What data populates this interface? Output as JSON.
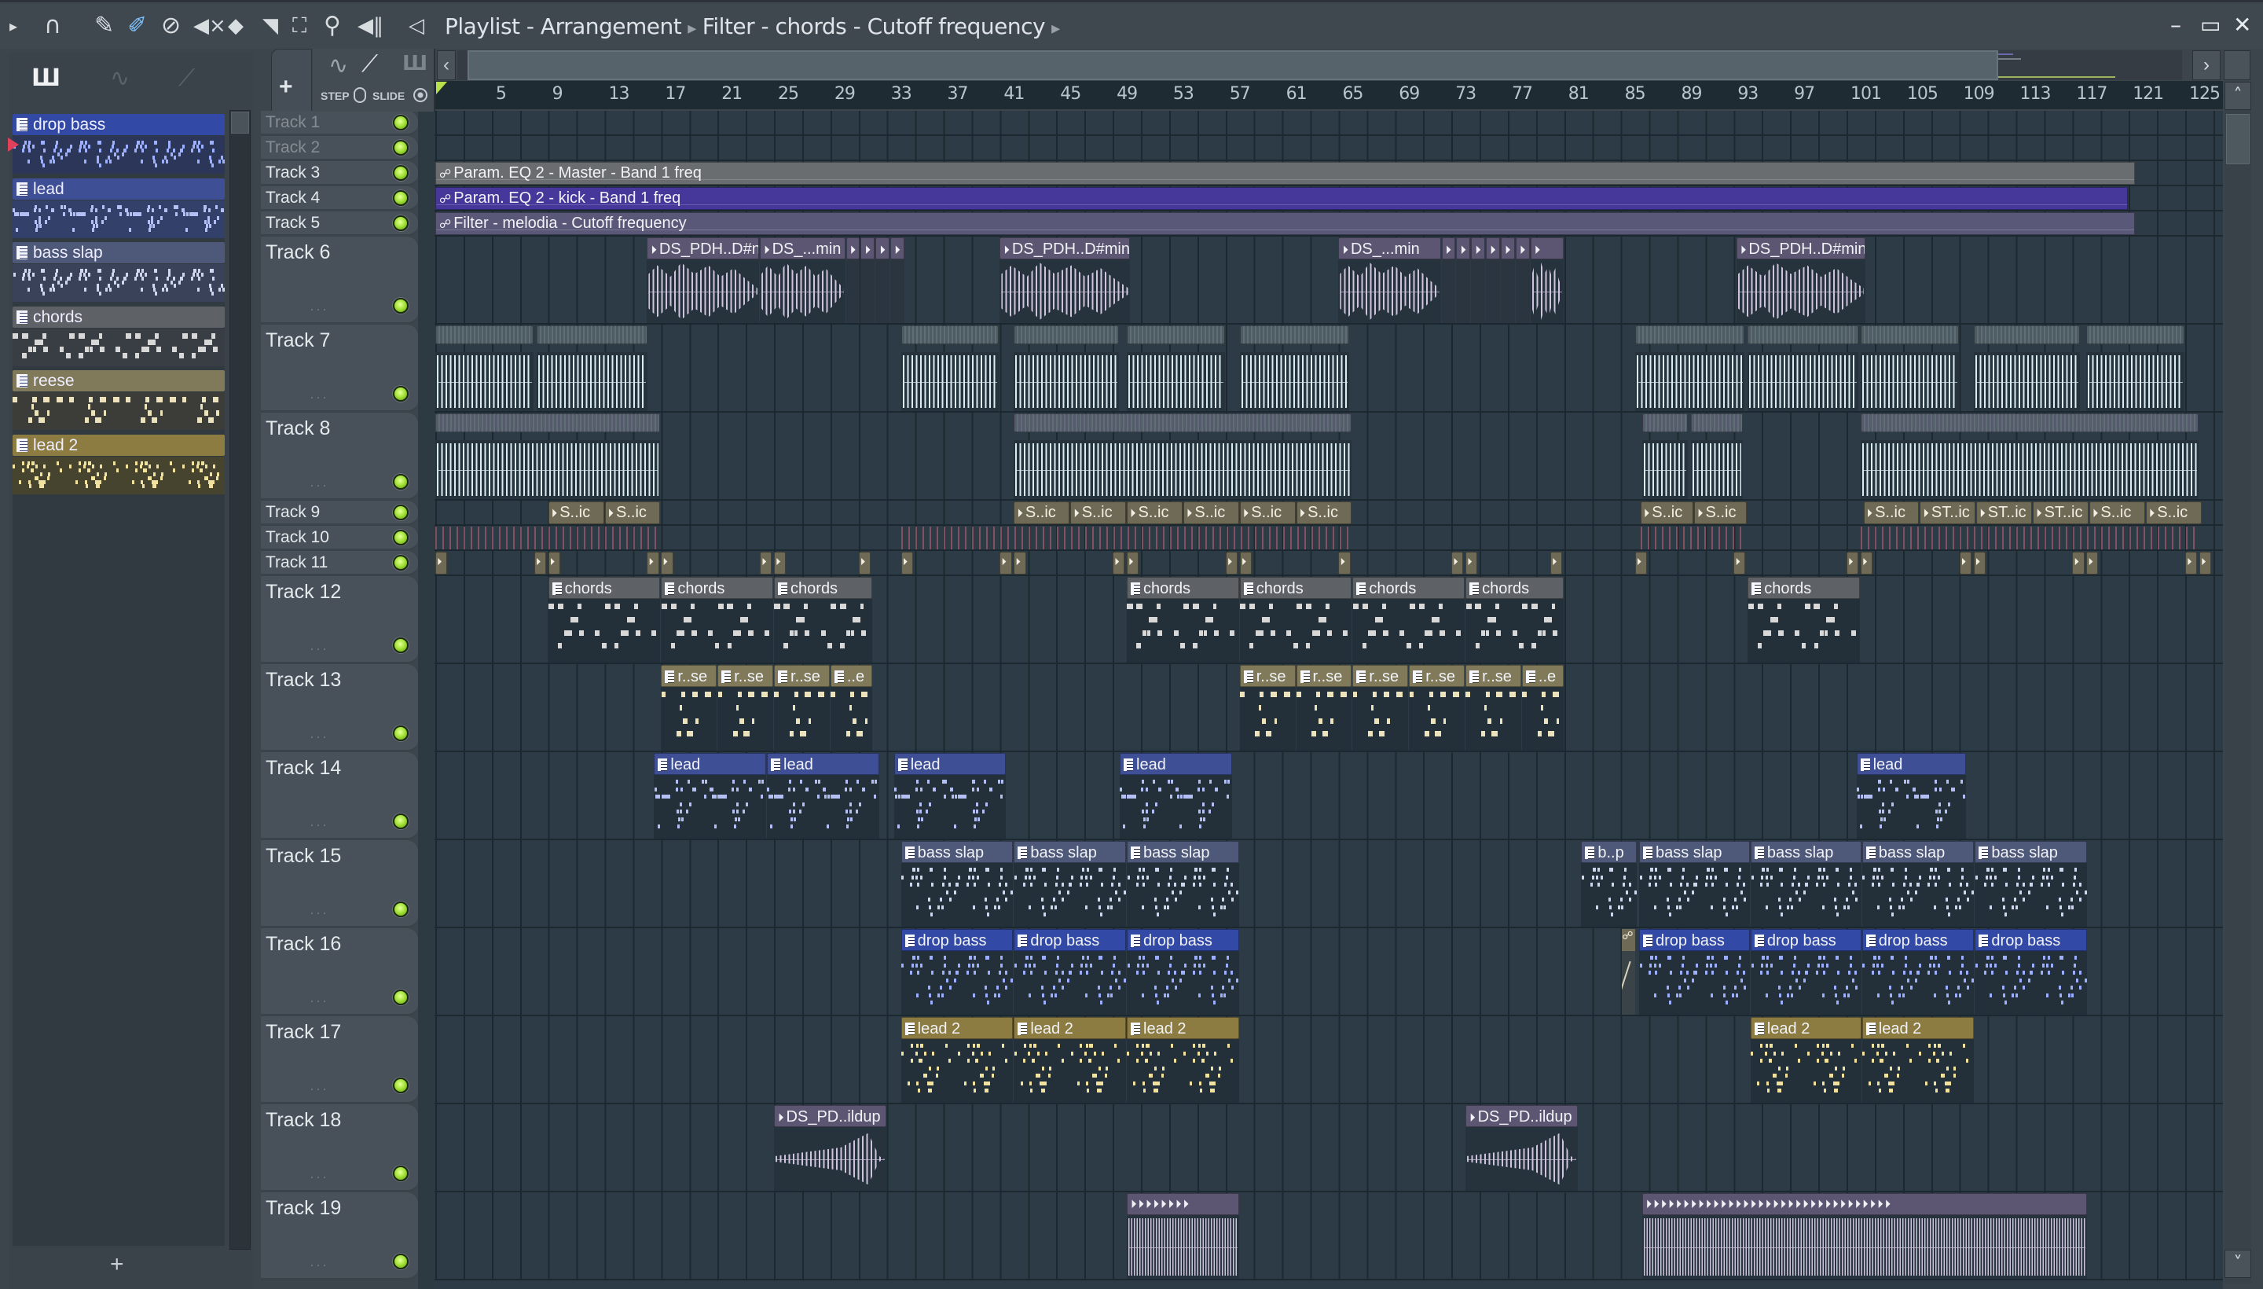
{
  "window": {
    "breadcrumb": [
      "Playlist - Arrangement",
      "Filter - chords - Cutoff frequency"
    ],
    "controls": [
      "minimize-icon",
      "maximize-icon",
      "close-icon"
    ]
  },
  "toolbar": {
    "icons": [
      "menu-arrow-icon",
      "magnet-snap-icon",
      "pencil-draw-icon",
      "paint-brush-icon",
      "delete-icon",
      "mute-icon",
      "slip-icon",
      "slice-icon",
      "select-icon",
      "zoom-icon",
      "playback-icon",
      "speaker-icon"
    ]
  },
  "left_panel": {
    "tool_icons": [
      "piano-roll-icon",
      "audio-clip-icon",
      "automation-clip-icon"
    ],
    "add_label": "+",
    "patterns": [
      {
        "name": "drop bass",
        "kind": "drop-bass"
      },
      {
        "name": "lead",
        "kind": "lead"
      },
      {
        "name": "bass slap",
        "kind": "bass-slap"
      },
      {
        "name": "chords",
        "kind": "chords"
      },
      {
        "name": "reese",
        "kind": "reese"
      },
      {
        "name": "lead 2",
        "kind": "lead2"
      }
    ]
  },
  "playlist_tools": {
    "add_label": "+",
    "step_label": "STEP",
    "slide_label": "SLIDE"
  },
  "ruler": {
    "ticks": [
      5,
      9,
      13,
      17,
      21,
      25,
      29,
      33,
      37,
      41,
      45,
      49,
      53,
      57,
      61,
      65,
      69,
      73,
      77,
      81,
      85,
      89,
      93,
      97,
      101,
      105,
      109,
      113,
      117,
      121,
      125
    ],
    "playhead_bar": 1
  },
  "tracks": [
    "Track 1",
    "Track 2",
    "Track 3",
    "Track 4",
    "Track 5",
    "Track 6",
    "Track 7",
    "Track 8",
    "Track 9",
    "Track 10",
    "Track 11",
    "Track 12",
    "Track 13",
    "Track 14",
    "Track 15",
    "Track 16",
    "Track 17",
    "Track 18",
    "Track 19"
  ],
  "colors": {
    "drop-bass": {
      "head": "#3349a6",
      "note": "#9cb0ff"
    },
    "lead": {
      "head": "#3f4f96",
      "note": "#b4c0f4"
    },
    "bass-slap": {
      "head": "#4e5878",
      "note": "#d0d6ee"
    },
    "chords": {
      "head": "#5e6165",
      "note": "#d8d8d8"
    },
    "reese": {
      "head": "#817a5a",
      "note": "#ece2bc"
    },
    "lead2": {
      "head": "#8c7c42",
      "note": "#f2e2a0"
    },
    "auto-master": {
      "head": "#6a6d70"
    },
    "auto-kick": {
      "head": "#45389a"
    },
    "auto-melodia": {
      "head": "#5a5878"
    },
    "audio-purple": {
      "head": "#5c5672",
      "wave": "#cfc4e0"
    },
    "audio-teal": {
      "head": "#4c5c62",
      "wave": "#d8ecf2"
    },
    "audio-slate": {
      "head": "#555a6c",
      "wave": "#d8ecf2"
    },
    "tan": {
      "head": "#6f6a55"
    },
    "hits": {
      "head": "#a05a6a"
    }
  },
  "clips": [
    {
      "t": 3,
      "s": 1,
      "l": 120.5,
      "kind": "auto-master",
      "label": "Param. EQ 2 - Master - Band 1 freq"
    },
    {
      "t": 4,
      "s": 1,
      "l": 120,
      "kind": "auto-kick",
      "label": "Param. EQ 2 - kick - Band 1 freq"
    },
    {
      "t": 5,
      "s": 1,
      "l": 120.5,
      "kind": "auto-melodia",
      "label": "Filter - melodia - Cutoff frequency"
    },
    {
      "t": 6,
      "s": 16,
      "l": 8,
      "kind": "audio6",
      "label": "DS_PDH..D#n"
    },
    {
      "t": 6,
      "s": 24,
      "l": 6.1,
      "kind": "audio6",
      "label": "DS_...min"
    },
    {
      "t": 6,
      "s": 30.1,
      "l": 1.05,
      "kind": "audio6",
      "label": ""
    },
    {
      "t": 6,
      "s": 31.15,
      "l": 1.05,
      "kind": "audio6",
      "label": ""
    },
    {
      "t": 6,
      "s": 32.2,
      "l": 1.05,
      "kind": "audio6",
      "label": ""
    },
    {
      "t": 6,
      "s": 33.25,
      "l": 1.05,
      "kind": "audio6",
      "label": ""
    },
    {
      "t": 6,
      "s": 41,
      "l": 9.3,
      "kind": "audio6",
      "label": "DS_PDH..D#min"
    },
    {
      "t": 6,
      "s": 65,
      "l": 7.3,
      "kind": "audio6",
      "label": "DS_...min"
    },
    {
      "t": 6,
      "s": 72.3,
      "l": 1.05,
      "kind": "audio6",
      "label": ""
    },
    {
      "t": 6,
      "s": 73.35,
      "l": 1.05,
      "kind": "audio6",
      "label": ""
    },
    {
      "t": 6,
      "s": 74.4,
      "l": 1.05,
      "kind": "audio6",
      "label": ""
    },
    {
      "t": 6,
      "s": 75.45,
      "l": 1.05,
      "kind": "audio6",
      "label": ""
    },
    {
      "t": 6,
      "s": 76.5,
      "l": 1.05,
      "kind": "audio6",
      "label": ""
    },
    {
      "t": 6,
      "s": 77.55,
      "l": 1.05,
      "kind": "audio6",
      "label": ""
    },
    {
      "t": 6,
      "s": 78.6,
      "l": 2.4,
      "kind": "audio6",
      "label": ""
    },
    {
      "t": 6,
      "s": 93.2,
      "l": 9.2,
      "kind": "audio6",
      "label": "DS_PDH..D#min"
    },
    {
      "t": 7,
      "s": 1,
      "l": 7,
      "kind": "audio7"
    },
    {
      "t": 7,
      "s": 8.2,
      "l": 7.9,
      "kind": "audio7"
    },
    {
      "t": 7,
      "s": 34,
      "l": 7,
      "kind": "audio7"
    },
    {
      "t": 7,
      "s": 42,
      "l": 7.5,
      "kind": "audio7"
    },
    {
      "t": 7,
      "s": 50,
      "l": 7,
      "kind": "audio7"
    },
    {
      "t": 7,
      "s": 58,
      "l": 7.8,
      "kind": "audio7"
    },
    {
      "t": 7,
      "s": 86,
      "l": 7.8,
      "kind": "audio7"
    },
    {
      "t": 7,
      "s": 94,
      "l": 7.9,
      "kind": "audio7"
    },
    {
      "t": 7,
      "s": 102,
      "l": 7,
      "kind": "audio7"
    },
    {
      "t": 7,
      "s": 110,
      "l": 7.6,
      "kind": "audio7"
    },
    {
      "t": 7,
      "s": 118,
      "l": 7,
      "kind": "audio7"
    },
    {
      "t": 8,
      "s": 1,
      "l": 16,
      "kind": "audio8"
    },
    {
      "t": 8,
      "s": 42,
      "l": 24,
      "kind": "audio8"
    },
    {
      "t": 8,
      "s": 86.5,
      "l": 3.3,
      "kind": "audio8"
    },
    {
      "t": 8,
      "s": 90,
      "l": 3.7,
      "kind": "audio8"
    },
    {
      "t": 8,
      "s": 102,
      "l": 24,
      "kind": "audio8"
    },
    {
      "t": 9,
      "s": 9,
      "l": 4,
      "kind": "sic",
      "label": "S..ic"
    },
    {
      "t": 9,
      "s": 13,
      "l": 4,
      "kind": "sic",
      "label": "S..ic"
    },
    {
      "t": 9,
      "s": 42,
      "l": 4,
      "kind": "sic",
      "label": "S..ic"
    },
    {
      "t": 9,
      "s": 46,
      "l": 4,
      "kind": "sic",
      "label": "S..ic"
    },
    {
      "t": 9,
      "s": 50,
      "l": 4,
      "kind": "sic",
      "label": "S..ic"
    },
    {
      "t": 9,
      "s": 54,
      "l": 4,
      "kind": "sic",
      "label": "S..ic"
    },
    {
      "t": 9,
      "s": 58,
      "l": 4,
      "kind": "sic",
      "label": "S..ic"
    },
    {
      "t": 9,
      "s": 62,
      "l": 4,
      "kind": "sic",
      "label": "S..ic"
    },
    {
      "t": 9,
      "s": 86.4,
      "l": 3.8,
      "kind": "sic",
      "label": "S..ic"
    },
    {
      "t": 9,
      "s": 90.2,
      "l": 3.8,
      "kind": "sic",
      "label": "S..ic"
    },
    {
      "t": 9,
      "s": 102.2,
      "l": 4,
      "kind": "sic",
      "label": "S..ic"
    },
    {
      "t": 9,
      "s": 106.2,
      "l": 4,
      "kind": "sic",
      "label": "ST..ic"
    },
    {
      "t": 9,
      "s": 110.2,
      "l": 4,
      "kind": "sic",
      "label": "ST..ic"
    },
    {
      "t": 9,
      "s": 114.2,
      "l": 4,
      "kind": "sic",
      "label": "ST..ic"
    },
    {
      "t": 9,
      "s": 118.2,
      "l": 4,
      "kind": "sic",
      "label": "S..ic"
    },
    {
      "t": 9,
      "s": 122.2,
      "l": 4,
      "kind": "sic",
      "label": "S..ic"
    },
    {
      "t": 10,
      "s": 1,
      "l": 16,
      "kind": "hits"
    },
    {
      "t": 10,
      "s": 34,
      "l": 32,
      "kind": "hits"
    },
    {
      "t": 10,
      "s": 86.4,
      "l": 7.6,
      "kind": "hits"
    },
    {
      "t": 10,
      "s": 102,
      "l": 24,
      "kind": "hits"
    },
    {
      "t": 11,
      "s": 1,
      "l": 0.9,
      "kind": "hit"
    },
    {
      "t": 11,
      "s": 8,
      "l": 0.9,
      "kind": "hit"
    },
    {
      "t": 11,
      "s": 9,
      "l": 0.9,
      "kind": "hit"
    },
    {
      "t": 11,
      "s": 16,
      "l": 0.9,
      "kind": "hit"
    },
    {
      "t": 11,
      "s": 17,
      "l": 0.9,
      "kind": "hit"
    },
    {
      "t": 11,
      "s": 24,
      "l": 0.9,
      "kind": "hit"
    },
    {
      "t": 11,
      "s": 25,
      "l": 0.9,
      "kind": "hit"
    },
    {
      "t": 11,
      "s": 31,
      "l": 0.9,
      "kind": "hit"
    },
    {
      "t": 11,
      "s": 34,
      "l": 0.9,
      "kind": "hit"
    },
    {
      "t": 11,
      "s": 41,
      "l": 0.9,
      "kind": "hit"
    },
    {
      "t": 11,
      "s": 42,
      "l": 0.9,
      "kind": "hit"
    },
    {
      "t": 11,
      "s": 49,
      "l": 0.9,
      "kind": "hit"
    },
    {
      "t": 11,
      "s": 50,
      "l": 0.9,
      "kind": "hit"
    },
    {
      "t": 11,
      "s": 57,
      "l": 0.9,
      "kind": "hit"
    },
    {
      "t": 11,
      "s": 58,
      "l": 0.9,
      "kind": "hit"
    },
    {
      "t": 11,
      "s": 65,
      "l": 0.9,
      "kind": "hit"
    },
    {
      "t": 11,
      "s": 73,
      "l": 0.9,
      "kind": "hit"
    },
    {
      "t": 11,
      "s": 74,
      "l": 0.9,
      "kind": "hit"
    },
    {
      "t": 11,
      "s": 80,
      "l": 0.9,
      "kind": "hit"
    },
    {
      "t": 11,
      "s": 86,
      "l": 0.9,
      "kind": "hit"
    },
    {
      "t": 11,
      "s": 93,
      "l": 0.9,
      "kind": "hit"
    },
    {
      "t": 11,
      "s": 101,
      "l": 0.9,
      "kind": "hit"
    },
    {
      "t": 11,
      "s": 102,
      "l": 0.9,
      "kind": "hit"
    },
    {
      "t": 11,
      "s": 109,
      "l": 0.9,
      "kind": "hit"
    },
    {
      "t": 11,
      "s": 110,
      "l": 0.9,
      "kind": "hit"
    },
    {
      "t": 11,
      "s": 117,
      "l": 0.9,
      "kind": "hit"
    },
    {
      "t": 11,
      "s": 118,
      "l": 0.9,
      "kind": "hit"
    },
    {
      "t": 11,
      "s": 125,
      "l": 0.9,
      "kind": "hit"
    },
    {
      "t": 11,
      "s": 126,
      "l": 0.9,
      "kind": "hit"
    },
    {
      "t": 12,
      "s": 9,
      "l": 8,
      "kind": "chords",
      "label": "chords"
    },
    {
      "t": 12,
      "s": 17,
      "l": 8,
      "kind": "chords",
      "label": "chords"
    },
    {
      "t": 12,
      "s": 25,
      "l": 7,
      "kind": "chords",
      "label": "chords"
    },
    {
      "t": 12,
      "s": 50,
      "l": 8,
      "kind": "chords",
      "label": "chords"
    },
    {
      "t": 12,
      "s": 58,
      "l": 8,
      "kind": "chords",
      "label": "chords"
    },
    {
      "t": 12,
      "s": 66,
      "l": 8,
      "kind": "chords",
      "label": "chords"
    },
    {
      "t": 12,
      "s": 74,
      "l": 7,
      "kind": "chords",
      "label": "chords"
    },
    {
      "t": 12,
      "s": 94,
      "l": 8,
      "kind": "chords",
      "label": "chords"
    },
    {
      "t": 13,
      "s": 17,
      "l": 4,
      "kind": "reese",
      "label": "r..se"
    },
    {
      "t": 13,
      "s": 21,
      "l": 4,
      "kind": "reese",
      "label": "r..se"
    },
    {
      "t": 13,
      "s": 25,
      "l": 4,
      "kind": "reese",
      "label": "r..se"
    },
    {
      "t": 13,
      "s": 29,
      "l": 3,
      "kind": "reese",
      "label": "..e"
    },
    {
      "t": 13,
      "s": 58,
      "l": 4,
      "kind": "reese",
      "label": "r..se"
    },
    {
      "t": 13,
      "s": 62,
      "l": 4,
      "kind": "reese",
      "label": "r..se"
    },
    {
      "t": 13,
      "s": 66,
      "l": 4,
      "kind": "reese",
      "label": "r..se"
    },
    {
      "t": 13,
      "s": 70,
      "l": 4,
      "kind": "reese",
      "label": "r..se"
    },
    {
      "t": 13,
      "s": 74,
      "l": 4,
      "kind": "reese",
      "label": "r..se"
    },
    {
      "t": 13,
      "s": 78,
      "l": 3,
      "kind": "reese",
      "label": "..e"
    },
    {
      "t": 14,
      "s": 16.5,
      "l": 8,
      "kind": "lead",
      "label": "lead"
    },
    {
      "t": 14,
      "s": 24.5,
      "l": 8,
      "kind": "lead",
      "label": "lead"
    },
    {
      "t": 14,
      "s": 33.5,
      "l": 8,
      "kind": "lead",
      "label": "lead"
    },
    {
      "t": 14,
      "s": 49.5,
      "l": 8,
      "kind": "lead",
      "label": "lead"
    },
    {
      "t": 14,
      "s": 101.7,
      "l": 7.8,
      "kind": "lead",
      "label": "lead"
    },
    {
      "t": 15,
      "s": 34,
      "l": 8,
      "kind": "bass-slap",
      "label": "bass slap"
    },
    {
      "t": 15,
      "s": 42,
      "l": 8,
      "kind": "bass-slap",
      "label": "bass slap"
    },
    {
      "t": 15,
      "s": 50,
      "l": 8,
      "kind": "bass-slap",
      "label": "bass slap"
    },
    {
      "t": 15,
      "s": 82.2,
      "l": 4,
      "kind": "bass-slap",
      "label": "b..p"
    },
    {
      "t": 15,
      "s": 86.3,
      "l": 7.9,
      "kind": "bass-slap",
      "label": "bass slap"
    },
    {
      "t": 15,
      "s": 94.2,
      "l": 7.9,
      "kind": "bass-slap",
      "label": "bass slap"
    },
    {
      "t": 15,
      "s": 102.1,
      "l": 8,
      "kind": "bass-slap",
      "label": "bass slap"
    },
    {
      "t": 15,
      "s": 110.1,
      "l": 8,
      "kind": "bass-slap",
      "label": "bass slap"
    },
    {
      "t": 16,
      "s": 34,
      "l": 8,
      "kind": "drop-bass",
      "label": "drop bass"
    },
    {
      "t": 16,
      "s": 42,
      "l": 8,
      "kind": "drop-bass",
      "label": "drop bass"
    },
    {
      "t": 16,
      "s": 50,
      "l": 8,
      "kind": "drop-bass",
      "label": "drop bass"
    },
    {
      "t": 16,
      "s": 85.1,
      "l": 1,
      "kind": "auto-small",
      "label": ""
    },
    {
      "t": 16,
      "s": 86.3,
      "l": 7.9,
      "kind": "drop-bass",
      "label": "drop bass"
    },
    {
      "t": 16,
      "s": 94.2,
      "l": 7.9,
      "kind": "drop-bass",
      "label": "drop bass"
    },
    {
      "t": 16,
      "s": 102.1,
      "l": 8,
      "kind": "drop-bass",
      "label": "drop bass"
    },
    {
      "t": 16,
      "s": 110.1,
      "l": 8,
      "kind": "drop-bass",
      "label": "drop bass"
    },
    {
      "t": 17,
      "s": 34,
      "l": 8,
      "kind": "lead2",
      "label": "lead 2"
    },
    {
      "t": 17,
      "s": 42,
      "l": 8,
      "kind": "lead2",
      "label": "lead 2"
    },
    {
      "t": 17,
      "s": 50,
      "l": 8,
      "kind": "lead2",
      "label": "lead 2"
    },
    {
      "t": 17,
      "s": 94.2,
      "l": 7.9,
      "kind": "lead2",
      "label": "lead 2"
    },
    {
      "t": 17,
      "s": 102.1,
      "l": 8,
      "kind": "lead2",
      "label": "lead 2"
    },
    {
      "t": 18,
      "s": 25,
      "l": 8,
      "kind": "audio18",
      "label": "DS_PD..ildup"
    },
    {
      "t": 18,
      "s": 74,
      "l": 8,
      "kind": "audio18",
      "label": "DS_PD..ildup"
    },
    {
      "t": 19,
      "s": 50,
      "l": 8,
      "kind": "audio19"
    },
    {
      "t": 19,
      "s": 86.5,
      "l": 31.6,
      "kind": "audio19"
    }
  ]
}
